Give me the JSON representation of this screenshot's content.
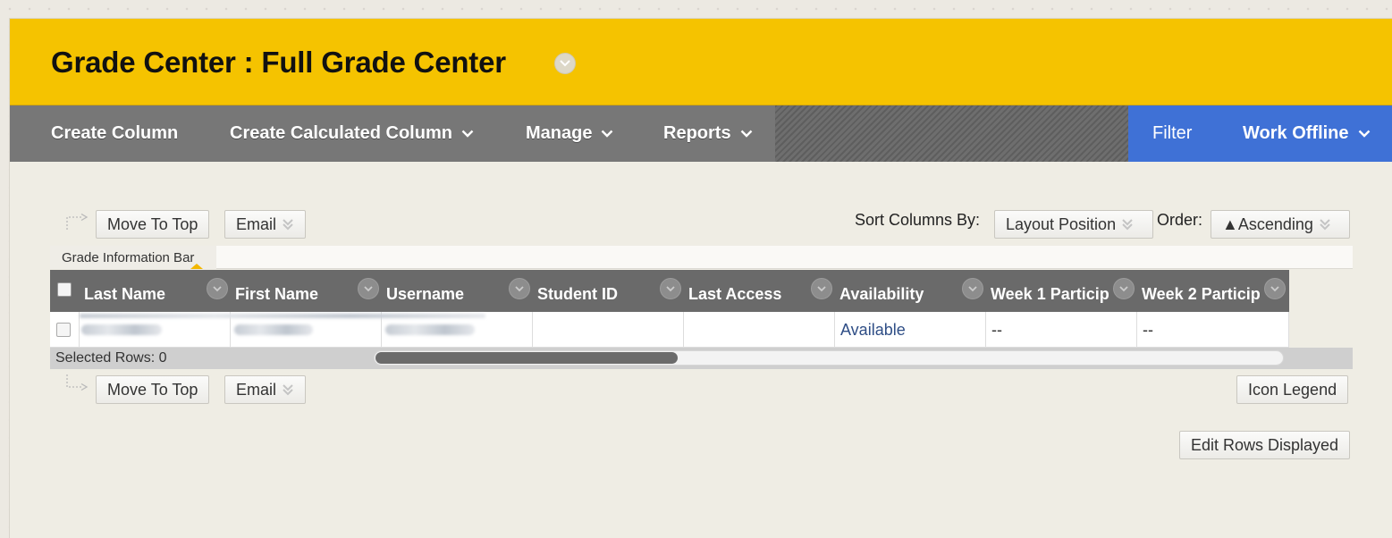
{
  "header": {
    "title": "Grade Center : Full Grade Center"
  },
  "action_bar": {
    "create_column": "Create Column",
    "create_calculated_column": "Create Calculated Column",
    "manage": "Manage",
    "reports": "Reports",
    "filter": "Filter",
    "work_offline": "Work Offline"
  },
  "toolbar_top": {
    "move_to_top": "Move To Top",
    "email": "Email",
    "sort_label": "Sort Columns By:",
    "sort_value": "Layout Position",
    "order_label": "Order:",
    "order_value": "▲Ascending"
  },
  "grade_info_bar": {
    "label": "Grade Information Bar"
  },
  "grid": {
    "columns": [
      "Last Name",
      "First Name",
      "Username",
      "Student ID",
      "Last Access",
      "Availability",
      "Week 1 Particip",
      "Week 2 Particip"
    ],
    "rows": [
      {
        "last_name": "",
        "first_name": "",
        "username": "",
        "student_id": "",
        "last_access": "",
        "availability": "Available",
        "week1": "--",
        "week2": "--"
      }
    ]
  },
  "selected_rows": "Selected Rows: 0",
  "toolbar_bottom": {
    "move_to_top": "Move To Top",
    "email": "Email",
    "icon_legend": "Icon Legend",
    "edit_rows_displayed": "Edit Rows Displayed"
  },
  "colors": {
    "header_yellow": "#f5c300",
    "action_gray": "#777777",
    "accent_blue": "#3f71d6",
    "grid_header": "#6a6a6a",
    "link_blue": "#2f4e86"
  }
}
